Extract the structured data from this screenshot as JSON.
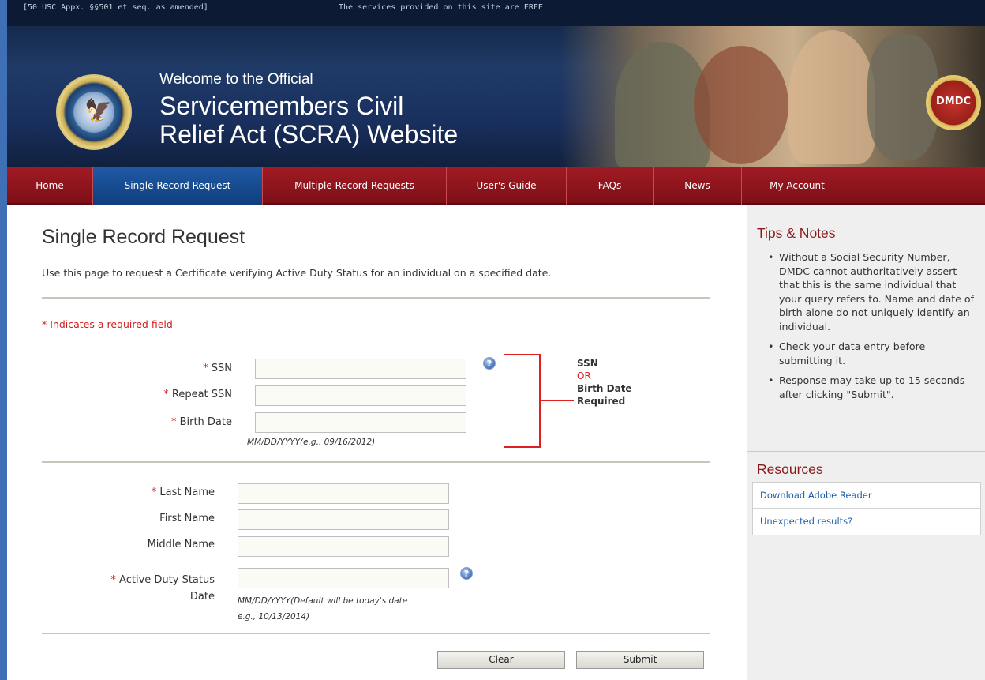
{
  "header": {
    "legal_text": "[50 USC Appx. §§501 et seq. as amended]",
    "free_text": "The services provided on this site are FREE",
    "welcome": "Welcome to the Official",
    "title_line1": "Servicemembers Civil",
    "title_line2": "Relief Act (SCRA) Website",
    "dmdc_badge": "DMDC"
  },
  "nav": {
    "items": [
      {
        "label": "Home",
        "active": false
      },
      {
        "label": "Single Record Request",
        "active": true
      },
      {
        "label": "Multiple Record Requests",
        "active": false
      },
      {
        "label": "User's Guide",
        "active": false
      },
      {
        "label": "FAQs",
        "active": false
      },
      {
        "label": "News",
        "active": false
      },
      {
        "label": "My Account",
        "active": false
      }
    ]
  },
  "main": {
    "title": "Single Record Request",
    "intro": "Use this page to request a Certificate verifying Active Duty Status for an individual on a specified date.",
    "required_note": "Indicates a required field",
    "required_marker": "*",
    "fields": {
      "ssn": {
        "label": "SSN",
        "value": ""
      },
      "repeat_ssn": {
        "label": "Repeat SSN",
        "value": ""
      },
      "birth_date": {
        "label": "Birth Date",
        "value": "",
        "hint": "MM/DD/YYYY(e.g., 09/16/2012)"
      },
      "last_name": {
        "label": "Last Name",
        "value": ""
      },
      "first_name": {
        "label": "First Name",
        "value": ""
      },
      "middle_name": {
        "label": "Middle Name",
        "value": ""
      },
      "active_duty_date": {
        "label_line1": "Active Duty Status",
        "label_line2": "Date",
        "value": "",
        "hint_line1": "MM/DD/YYYY(Default will be today's date",
        "hint_line2": "e.g., 10/13/2014)"
      }
    },
    "or_block": {
      "line1": "SSN",
      "line2": "OR",
      "line3": "Birth Date",
      "line4": "Required"
    },
    "buttons": {
      "clear": "Clear",
      "submit": "Submit"
    },
    "help_icon_glyph": "?"
  },
  "sidebar": {
    "tips_title": "Tips & Notes",
    "tips": [
      "Without a Social Security Number, DMDC cannot authoritatively assert that this is the same individual that your query refers to. Name and date of birth alone do not uniquely identify an individual.",
      "Check your data entry before submitting it.",
      "Response may take up to 15 seconds after clicking \"Submit\"."
    ],
    "resources_title": "Resources",
    "resources": [
      "Download Adobe Reader",
      "Unexpected results?"
    ]
  },
  "colors": {
    "nav_red": "#8e141c",
    "nav_active_blue": "#1a4f94",
    "required_red": "#d21d1d",
    "sidebar_title": "#8a1a1a",
    "link_blue": "#1b5fa8"
  }
}
